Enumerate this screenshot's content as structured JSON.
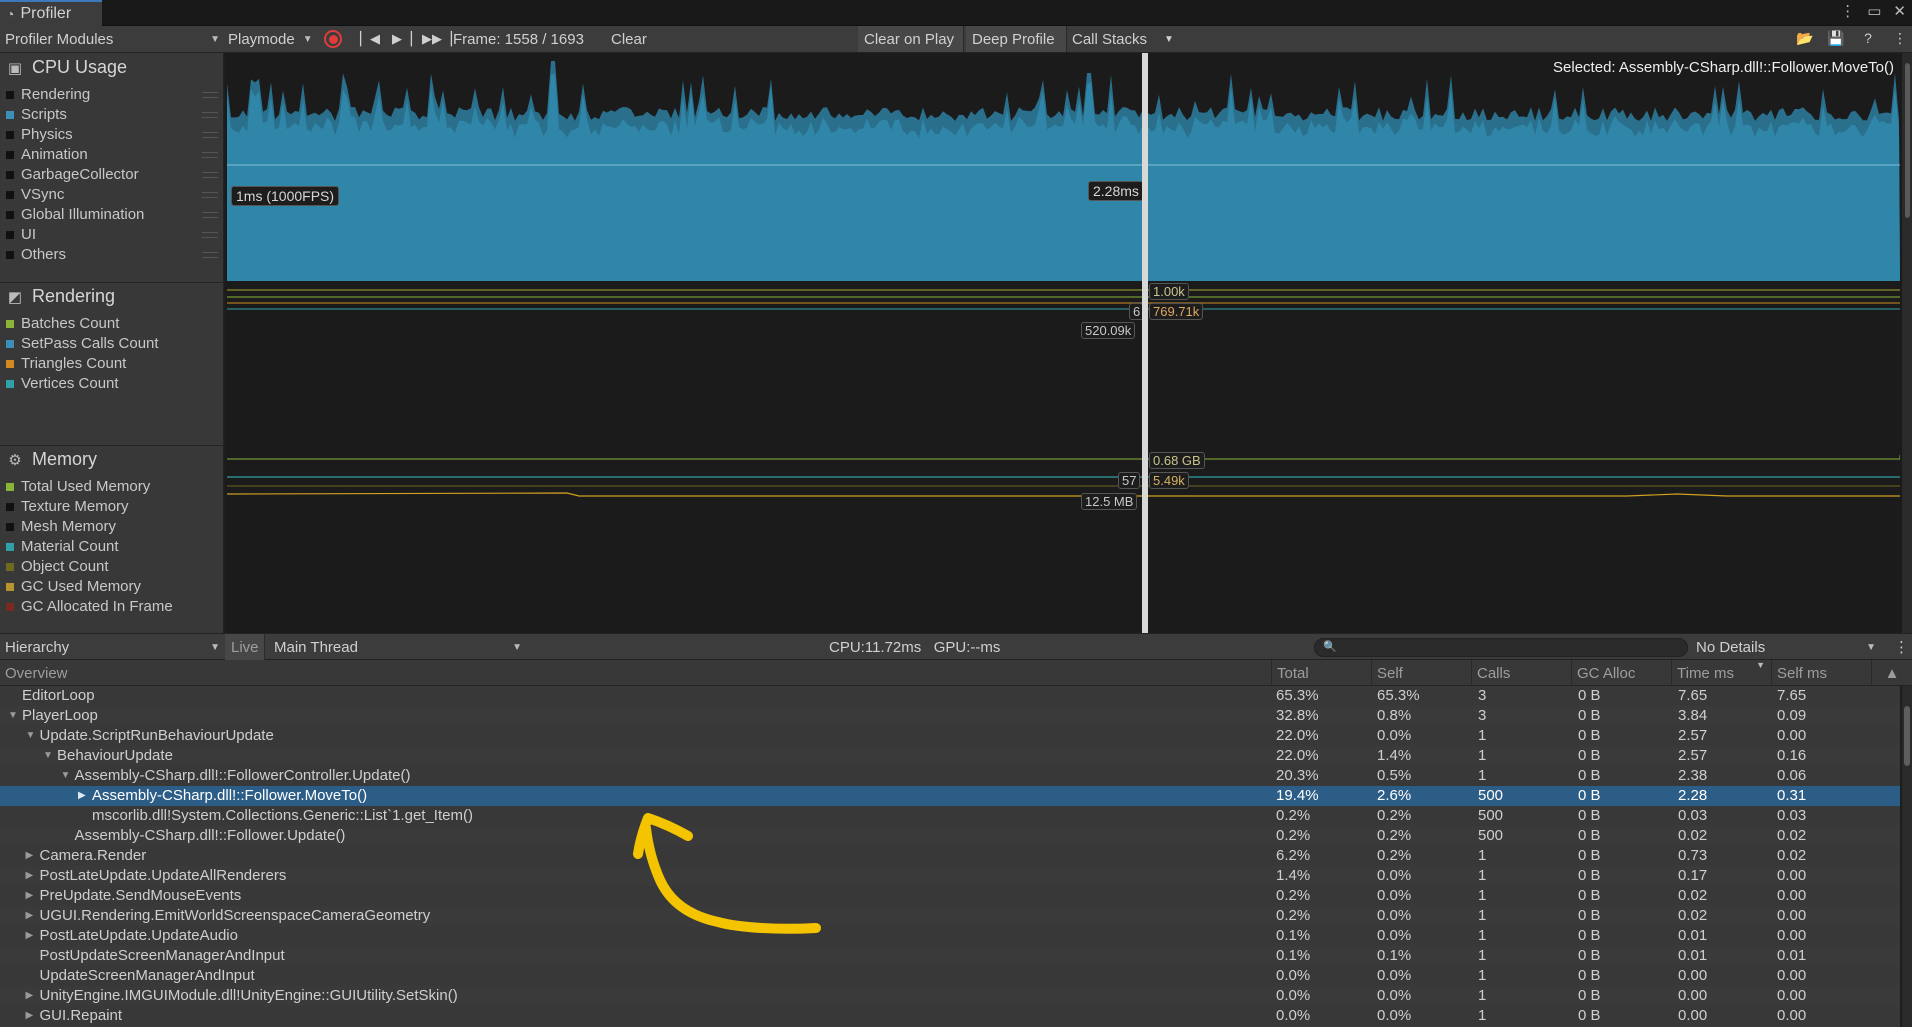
{
  "window": {
    "tab_title": "Profiler",
    "controls": [
      "⋮",
      "▭",
      "✕"
    ]
  },
  "toolbar": {
    "modules_dropdown": "Profiler Modules",
    "playmode_dropdown": "Playmode",
    "frame_label": "Frame: 1558 / 1693",
    "clear": "Clear",
    "clear_on_play": "Clear on Play",
    "deep_profile": "Deep Profile",
    "call_stacks": "Call Stacks",
    "record_color": "#e03c3c"
  },
  "modules": {
    "cpu": {
      "title": "CPU Usage",
      "legend": [
        {
          "label": "Rendering",
          "color": "#111111"
        },
        {
          "label": "Scripts",
          "color": "#3b8fb8"
        },
        {
          "label": "Physics",
          "color": "#111111"
        },
        {
          "label": "Animation",
          "color": "#111111"
        },
        {
          "label": "GarbageCollector",
          "color": "#111111"
        },
        {
          "label": "VSync",
          "color": "#111111"
        },
        {
          "label": "Global Illumination",
          "color": "#111111"
        },
        {
          "label": "UI",
          "color": "#111111"
        },
        {
          "label": "Others",
          "color": "#111111"
        }
      ]
    },
    "rendering": {
      "title": "Rendering",
      "legend": [
        {
          "label": "Batches Count",
          "color": "#8ab33a"
        },
        {
          "label": "SetPass Calls Count",
          "color": "#3b8fb8"
        },
        {
          "label": "Triangles Count",
          "color": "#d08a1e"
        },
        {
          "label": "Vertices Count",
          "color": "#2f9fa8"
        }
      ]
    },
    "memory": {
      "title": "Memory",
      "legend": [
        {
          "label": "Total Used Memory",
          "color": "#8ab33a"
        },
        {
          "label": "Texture Memory",
          "color": "#111111"
        },
        {
          "label": "Mesh Memory",
          "color": "#111111"
        },
        {
          "label": "Material Count",
          "color": "#2f9fa8"
        },
        {
          "label": "Object Count",
          "color": "#6e6a22"
        },
        {
          "label": "GC Used Memory",
          "color": "#b8942c"
        },
        {
          "label": "GC Allocated In Frame",
          "color": "#7a2a1e"
        }
      ]
    }
  },
  "charts": {
    "selected": "Selected: Assembly-CSharp.dll!::Follower.MoveTo()",
    "cpu_fps_label": "1ms (1000FPS)",
    "cpu_value_label": "2.28ms",
    "cpu_area_color": "#2f86a8",
    "rendering_labels": {
      "a": "1.00k",
      "b": "6",
      "c": "769.71k",
      "d": "520.09k"
    },
    "memory_labels": {
      "a": "0.68 GB",
      "b": "57",
      "c": "5.49k",
      "d": "12.5 MB"
    }
  },
  "details_toolbar": {
    "view_dropdown": "Hierarchy",
    "live": "Live",
    "thread_dropdown": "Main Thread",
    "cpu_gpu": "CPU:11.72ms   GPU:--ms",
    "details_dropdown": "No Details"
  },
  "table": {
    "columns": [
      "Overview",
      "Total",
      "Self",
      "Calls",
      "GC Alloc",
      "Time ms",
      "Self ms"
    ],
    "rows": [
      {
        "name": "EditorLoop",
        "depth": 0,
        "arrow": "",
        "total": "65.3%",
        "self": "65.3%",
        "calls": "3",
        "gc": "0 B",
        "time": "7.65",
        "selfms": "7.65"
      },
      {
        "name": "PlayerLoop",
        "depth": 0,
        "arrow": "▼",
        "total": "32.8%",
        "self": "0.8%",
        "calls": "3",
        "gc": "0 B",
        "time": "3.84",
        "selfms": "0.09"
      },
      {
        "name": "Update.ScriptRunBehaviourUpdate",
        "depth": 1,
        "arrow": "▼",
        "total": "22.0%",
        "self": "0.0%",
        "calls": "1",
        "gc": "0 B",
        "time": "2.57",
        "selfms": "0.00"
      },
      {
        "name": "BehaviourUpdate",
        "depth": 2,
        "arrow": "▼",
        "total": "22.0%",
        "self": "1.4%",
        "calls": "1",
        "gc": "0 B",
        "time": "2.57",
        "selfms": "0.16"
      },
      {
        "name": "Assembly-CSharp.dll!::FollowerController.Update()",
        "depth": 3,
        "arrow": "▼",
        "total": "20.3%",
        "self": "0.5%",
        "calls": "1",
        "gc": "0 B",
        "time": "2.38",
        "selfms": "0.06"
      },
      {
        "name": "Assembly-CSharp.dll!::Follower.MoveTo()",
        "depth": 4,
        "arrow": "▶",
        "total": "19.4%",
        "self": "2.6%",
        "calls": "500",
        "gc": "0 B",
        "time": "2.28",
        "selfms": "0.31",
        "selected": true
      },
      {
        "name": "mscorlib.dll!System.Collections.Generic::List`1.get_Item()",
        "depth": 4,
        "arrow": "",
        "total": "0.2%",
        "self": "0.2%",
        "calls": "500",
        "gc": "0 B",
        "time": "0.03",
        "selfms": "0.03"
      },
      {
        "name": "Assembly-CSharp.dll!::Follower.Update()",
        "depth": 3,
        "arrow": "",
        "total": "0.2%",
        "self": "0.2%",
        "calls": "500",
        "gc": "0 B",
        "time": "0.02",
        "selfms": "0.02"
      },
      {
        "name": "Camera.Render",
        "depth": 1,
        "arrow": "▶",
        "total": "6.2%",
        "self": "0.2%",
        "calls": "1",
        "gc": "0 B",
        "time": "0.73",
        "selfms": "0.02"
      },
      {
        "name": "PostLateUpdate.UpdateAllRenderers",
        "depth": 1,
        "arrow": "▶",
        "total": "1.4%",
        "self": "0.0%",
        "calls": "1",
        "gc": "0 B",
        "time": "0.17",
        "selfms": "0.00"
      },
      {
        "name": "PreUpdate.SendMouseEvents",
        "depth": 1,
        "arrow": "▶",
        "total": "0.2%",
        "self": "0.0%",
        "calls": "1",
        "gc": "0 B",
        "time": "0.02",
        "selfms": "0.00"
      },
      {
        "name": "UGUI.Rendering.EmitWorldScreenspaceCameraGeometry",
        "depth": 1,
        "arrow": "▶",
        "total": "0.2%",
        "self": "0.0%",
        "calls": "1",
        "gc": "0 B",
        "time": "0.02",
        "selfms": "0.00"
      },
      {
        "name": "PostLateUpdate.UpdateAudio",
        "depth": 1,
        "arrow": "▶",
        "total": "0.1%",
        "self": "0.0%",
        "calls": "1",
        "gc": "0 B",
        "time": "0.01",
        "selfms": "0.00"
      },
      {
        "name": "PostUpdateScreenManagerAndInput",
        "depth": 1,
        "arrow": "",
        "total": "0.1%",
        "self": "0.1%",
        "calls": "1",
        "gc": "0 B",
        "time": "0.01",
        "selfms": "0.01"
      },
      {
        "name": "UpdateScreenManagerAndInput",
        "depth": 1,
        "arrow": "",
        "total": "0.0%",
        "self": "0.0%",
        "calls": "1",
        "gc": "0 B",
        "time": "0.00",
        "selfms": "0.00"
      },
      {
        "name": "UnityEngine.IMGUIModule.dll!UnityEngine::GUIUtility.SetSkin()",
        "depth": 1,
        "arrow": "▶",
        "total": "0.0%",
        "self": "0.0%",
        "calls": "1",
        "gc": "0 B",
        "time": "0.00",
        "selfms": "0.00"
      },
      {
        "name": "GUI.Repaint",
        "depth": 1,
        "arrow": "▶",
        "total": "0.0%",
        "self": "0.0%",
        "calls": "1",
        "gc": "0 B",
        "time": "0.00",
        "selfms": "0.00"
      }
    ]
  },
  "annotation": {
    "color": "#f5c400",
    "icon": "hand-drawn-arrow"
  }
}
